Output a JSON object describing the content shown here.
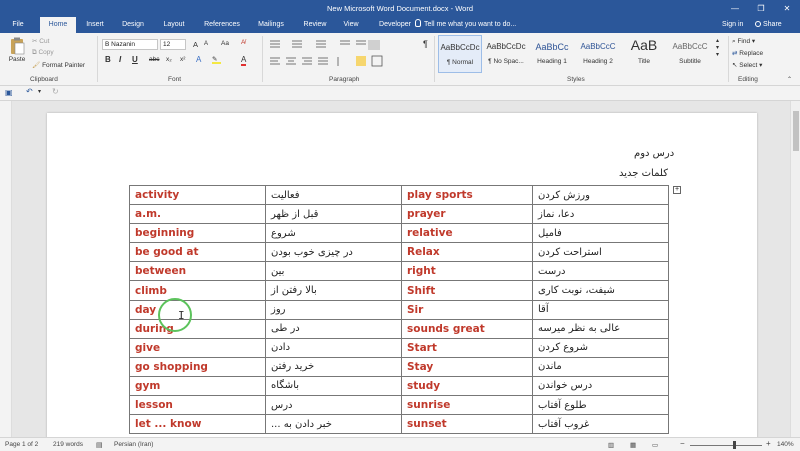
{
  "window": {
    "title": "New Microsoft Word Document.docx - Word",
    "controls": [
      "—",
      "❐",
      "✕"
    ]
  },
  "tabs": [
    {
      "label": "File"
    },
    {
      "label": "Home"
    },
    {
      "label": "Insert"
    },
    {
      "label": "Design"
    },
    {
      "label": "Layout"
    },
    {
      "label": "References"
    },
    {
      "label": "Mailings"
    },
    {
      "label": "Review"
    },
    {
      "label": "View"
    },
    {
      "label": "Developer"
    }
  ],
  "tell_me": "Tell me what you want to do...",
  "account": {
    "sign_in": "Sign in",
    "share": "Share"
  },
  "ribbon": {
    "clipboard": {
      "paste": "Paste",
      "cut": "Cut",
      "copy": "Copy",
      "format_painter": "Format Painter",
      "label": "Clipboard"
    },
    "font": {
      "name": "B Nazanin",
      "size": "12",
      "bold": "B",
      "italic": "I",
      "underline": "U",
      "strike": "abc",
      "subscript": "x₂",
      "superscript": "x²",
      "label": "Font",
      "grow": "A",
      "shrink": "A",
      "case": "Aa"
    },
    "paragraph": {
      "label": "Paragraph",
      "pilcrow": "¶"
    },
    "styles": {
      "label": "Styles",
      "items": [
        {
          "sample": "AaBbCcDc",
          "name": "¶ Normal"
        },
        {
          "sample": "AaBbCcDc",
          "name": "¶ No Spac..."
        },
        {
          "sample": "AaBbCc",
          "name": "Heading 1"
        },
        {
          "sample": "AaBbCcC",
          "name": "Heading 2"
        },
        {
          "sample": "AaB",
          "name": "Title"
        },
        {
          "sample": "AaBbCcC",
          "name": "Subtitle"
        }
      ]
    },
    "editing": {
      "find": "Find",
      "replace": "Replace",
      "select": "Select",
      "label": "Editing"
    }
  },
  "document": {
    "heading_line1": "درس دوم",
    "heading_line2": "کلمات جدید",
    "rows": [
      {
        "en1": "activity",
        "fa1": "فعالیت",
        "en2": "play sports",
        "fa2": "ورزش کردن"
      },
      {
        "en1": "a.m.",
        "fa1": "قبل از ظهر",
        "en2": "prayer",
        "fa2": "دعا، نماز"
      },
      {
        "en1": "beginning",
        "fa1": "شروع",
        "en2": "relative",
        "fa2": "فامیل"
      },
      {
        "en1": "be good at",
        "fa1": "در چیزی خوب بودن",
        "en2": "Relax",
        "fa2": "استراحت کردن"
      },
      {
        "en1": "between",
        "fa1": "بین",
        "en2": "right",
        "fa2": "درست"
      },
      {
        "en1": "climb",
        "fa1": "بالا رفتن از",
        "en2": "Shift",
        "fa2": "شیفت، نوبت کاری"
      },
      {
        "en1": "day",
        "fa1": "روز",
        "en2": "Sir",
        "fa2": "آقا"
      },
      {
        "en1": "during",
        "fa1": "در طی",
        "en2": "sounds great",
        "fa2": "عالی به نظر میرسه"
      },
      {
        "en1": "give",
        "fa1": "دادن",
        "en2": "Start",
        "fa2": "شروع کردن"
      },
      {
        "en1": "go shopping",
        "fa1": "خرید رفتن",
        "en2": "Stay",
        "fa2": "ماندن"
      },
      {
        "en1": "gym",
        "fa1": "باشگاه",
        "en2": "study",
        "fa2": "درس خواندن"
      },
      {
        "en1": "lesson",
        "fa1": "درس",
        "en2": "sunrise",
        "fa2": "طلوع آفتاب"
      },
      {
        "en1": "let ... know",
        "fa1": "خبر دادن به ...",
        "en2": "sunset",
        "fa2": "غروب آفتاب"
      }
    ]
  },
  "status": {
    "page": "Page 1 of 2",
    "words": "219 words",
    "language": "Persian (Iran)",
    "zoom": "140%",
    "zoom_minus": "−",
    "zoom_plus": "+"
  },
  "colors": {
    "ribbon_blue": "#2b579a",
    "vocab_red": "#c0392b",
    "cursor_ring": "#5cc35c"
  }
}
